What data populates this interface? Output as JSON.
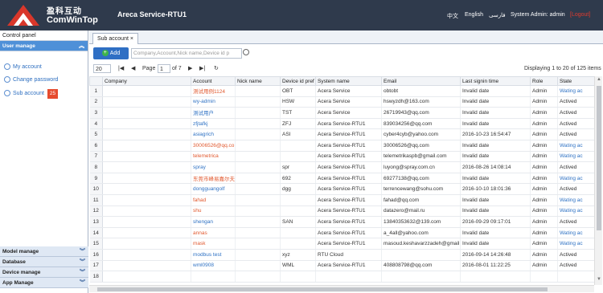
{
  "header": {
    "logo_cn": "盈科互动",
    "logo_en": "ComWinTop",
    "app_title": "Areca Service-RTU1",
    "lang_zh": "中文",
    "lang_en": "English",
    "lang_fa": "فارسی",
    "user": "System Admin: admin",
    "logout": "[Logout]",
    "bg_color": "#2f3a4c"
  },
  "sidebar": {
    "panel_title": "Control panel",
    "active_section": "User manage",
    "items": [
      {
        "label": "My account",
        "icon": "user-icon"
      },
      {
        "label": "Change password",
        "icon": "key-icon"
      },
      {
        "label": "Sub account",
        "icon": "users-icon",
        "badge": "25"
      }
    ],
    "bottom_sections": [
      "Model manage",
      "Database",
      "Device manage",
      "App Manage"
    ]
  },
  "tabs": [
    {
      "label": "Sub account",
      "close": "×"
    }
  ],
  "toolbar": {
    "add_label": "Add",
    "search_placeholder": "Company,Account,Nick name,Device id p"
  },
  "pager": {
    "page_size": "20",
    "page_label": "Page",
    "page": "1",
    "of_label": "of 7",
    "display": "Displaying 1 to 20 of 125 items"
  },
  "columns": [
    "Company",
    "Account",
    "Nick name",
    "Device id pref",
    "System name",
    "Email",
    "Last signin time",
    "Role",
    "State"
  ],
  "rows": [
    {
      "n": "1",
      "company": "",
      "account": "测试用例1124",
      "acolor": "orange",
      "nick": "",
      "dev": "OBT",
      "sys": "Acera Service",
      "email": "obtobt",
      "last": "Invalid date",
      "role": "Admin",
      "state": "Wating ac",
      "scolor": "blue"
    },
    {
      "n": "2",
      "company": "",
      "account": "wy-admin",
      "acolor": "blue",
      "nick": "",
      "dev": "HSW",
      "sys": "Acera Service",
      "email": "hswyzdh@163.com",
      "last": "Invalid date",
      "role": "Admin",
      "state": "Actived",
      "scolor": ""
    },
    {
      "n": "3",
      "company": "",
      "account": "测试用户",
      "acolor": "blue",
      "nick": "",
      "dev": "TST",
      "sys": "Acera Service",
      "email": "26719943@qq.com",
      "last": "Invalid date",
      "role": "Admin",
      "state": "Actived",
      "scolor": ""
    },
    {
      "n": "4",
      "company": "",
      "account": "zfjtafkj",
      "acolor": "blue",
      "nick": "",
      "dev": "ZFJ",
      "sys": "Acera Service-RTU1",
      "email": "839034256@qq.com",
      "last": "Invalid date",
      "role": "Admin",
      "state": "Actived",
      "scolor": ""
    },
    {
      "n": "5",
      "company": "",
      "account": "asiagrich",
      "acolor": "blue",
      "nick": "",
      "dev": "ASI",
      "sys": "Acera Service-RTU1",
      "email": "cyber4cyb@yahoo.com",
      "last": "2016-10-23 16:54:47",
      "role": "Admin",
      "state": "Actived",
      "scolor": ""
    },
    {
      "n": "6",
      "company": "",
      "account": "30006526@qq.co",
      "acolor": "orange",
      "nick": "",
      "dev": "",
      "sys": "Acera Service-RTU1",
      "email": "30006526@qq.com",
      "last": "Invalid date",
      "role": "Admin",
      "state": "Wating ac",
      "scolor": "blue"
    },
    {
      "n": "7",
      "company": "",
      "account": "telemetrica",
      "acolor": "orange",
      "nick": "",
      "dev": "",
      "sys": "Acera Service-RTU1",
      "email": "telemetrikaspb@gmail.com",
      "last": "Invalid date",
      "role": "Admin",
      "state": "Wating ac",
      "scolor": "blue"
    },
    {
      "n": "8",
      "company": "",
      "account": "spray",
      "acolor": "blue",
      "nick": "",
      "dev": "spr",
      "sys": "Acera Service-RTU1",
      "email": "luyong@spray.com.cn",
      "last": "2016-08-26 14:08:14",
      "role": "Admin",
      "state": "Actived",
      "scolor": ""
    },
    {
      "n": "9",
      "company": "",
      "account": "东莞市峰易嘉尔夫",
      "acolor": "orange",
      "nick": "",
      "dev": "692",
      "sys": "Acera Service-RTU1",
      "email": "69277138@qq.com",
      "last": "Invalid date",
      "role": "Admin",
      "state": "Wating ac",
      "scolor": "blue"
    },
    {
      "n": "10",
      "company": "",
      "account": "dongguangolf",
      "acolor": "blue",
      "nick": "",
      "dev": "dgg",
      "sys": "Acera Service-RTU1",
      "email": "terrencewang@sohu.com",
      "last": "2016-10-10 18:01:36",
      "role": "Admin",
      "state": "Actived",
      "scolor": ""
    },
    {
      "n": "11",
      "company": "",
      "account": "fahad",
      "acolor": "orange",
      "nick": "",
      "dev": "",
      "sys": "Acera Service-RTU1",
      "email": "fahad@qq.com",
      "last": "Invalid date",
      "role": "Admin",
      "state": "Wating ac",
      "scolor": "blue"
    },
    {
      "n": "12",
      "company": "",
      "account": "shu",
      "acolor": "orange",
      "nick": "",
      "dev": "",
      "sys": "Acera Service-RTU1",
      "email": "datazero@mail.ru",
      "last": "Invalid date",
      "role": "Admin",
      "state": "Wating ac",
      "scolor": "blue"
    },
    {
      "n": "13",
      "company": "",
      "account": "shengan",
      "acolor": "blue",
      "nick": "",
      "dev": "SAN",
      "sys": "Acera Service-RTU1",
      "email": "13840353632@139.com",
      "last": "2016-09-29 09:17:01",
      "role": "Admin",
      "state": "Actived",
      "scolor": ""
    },
    {
      "n": "14",
      "company": "",
      "account": "annas",
      "acolor": "orange",
      "nick": "",
      "dev": "",
      "sys": "Acera Service-RTU1",
      "email": "a_4all@yahoo.com",
      "last": "Invalid date",
      "role": "Admin",
      "state": "Wating ac",
      "scolor": "blue"
    },
    {
      "n": "15",
      "company": "",
      "account": "mask",
      "acolor": "orange",
      "nick": "",
      "dev": "",
      "sys": "Acera Service-RTU1",
      "email": "masoud.keshavarzzadeh@gmail",
      "last": "Invalid date",
      "role": "Admin",
      "state": "Wating ac",
      "scolor": "blue"
    },
    {
      "n": "16",
      "company": "",
      "account": "modbus test",
      "acolor": "blue",
      "nick": "",
      "dev": "xyz",
      "sys": "RTU Cloud",
      "email": "",
      "last": "2016-09-14 14:26:48",
      "role": "Admin",
      "state": "Actived",
      "scolor": ""
    },
    {
      "n": "17",
      "company": "",
      "account": "wml0908",
      "acolor": "blue",
      "nick": "",
      "dev": "WML",
      "sys": "Acera Service-RTU1",
      "email": "408808798@qq.com",
      "last": "2016-08-01 11:22:25",
      "role": "Admin",
      "state": "Actived",
      "scolor": ""
    },
    {
      "n": "18",
      "company": "",
      "account": "",
      "acolor": "",
      "nick": "",
      "dev": "",
      "sys": "",
      "email": "",
      "last": "",
      "role": "",
      "state": "",
      "scolor": ""
    }
  ]
}
